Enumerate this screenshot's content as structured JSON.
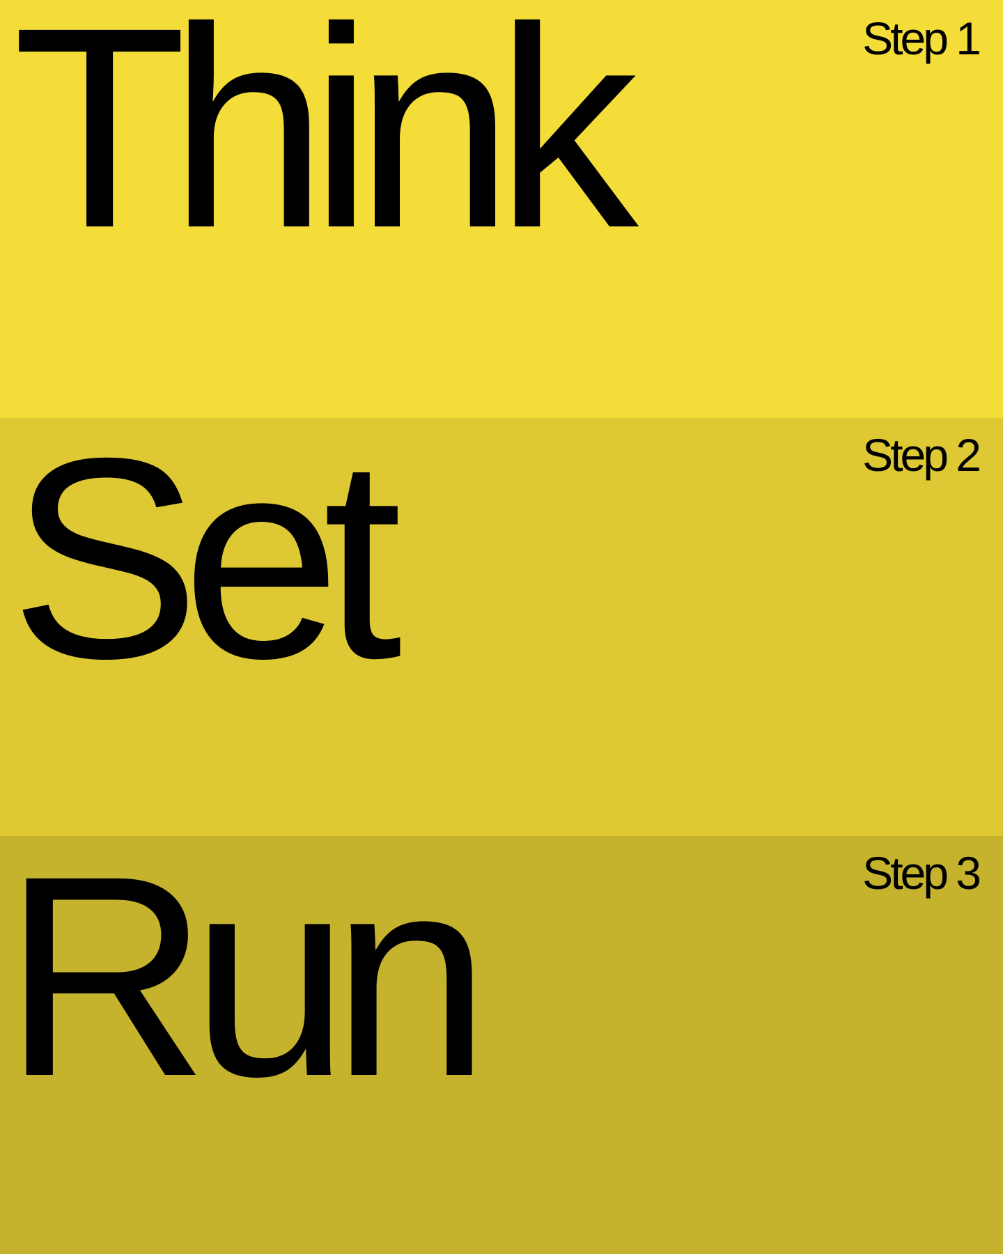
{
  "colors": {
    "band_1": "#f4dd39",
    "band_2": "#dec934",
    "band_3": "#c6b32d",
    "text": "#000000"
  },
  "panels": [
    {
      "word": "Think",
      "step": "Step 1"
    },
    {
      "word": "Set",
      "step": "Step 2"
    },
    {
      "word": "Run",
      "step": "Step 3"
    }
  ]
}
